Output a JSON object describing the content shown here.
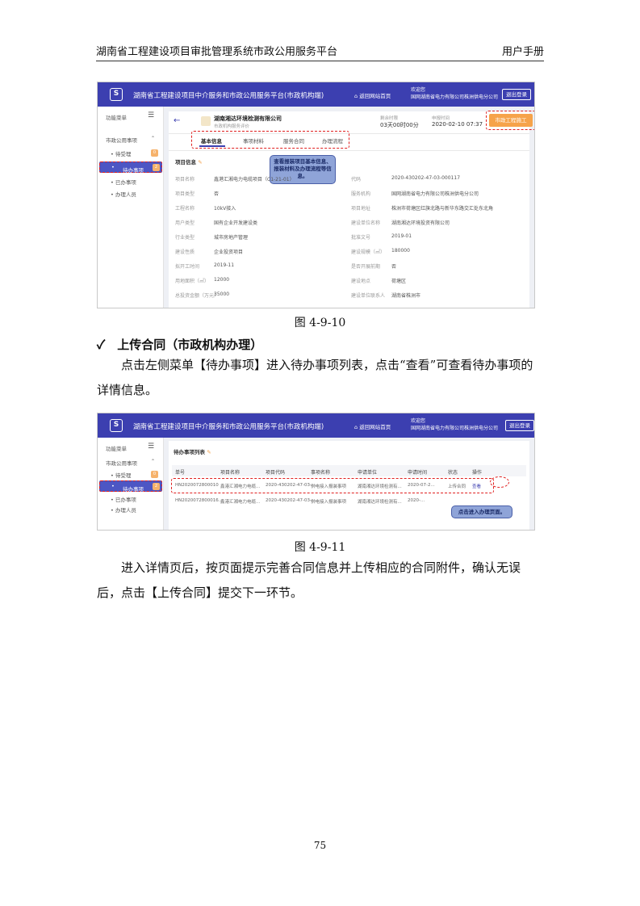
{
  "header": {
    "left": "湖南省工程建设项目审批管理系统市政公用服务平台",
    "right": "用户手册"
  },
  "shot1": {
    "app_title": "湖南省工程建设项目中介服务和市政公用服务平台(市政机构端)",
    "home": "返回网站首页",
    "welcome": "欢迎您",
    "org": "国网湖南省电力有限公司株洲供电分公司",
    "logout": "退出登录",
    "sidebar": {
      "title": "功能菜单",
      "group": "市政公用事项",
      "items": [
        "待受理",
        "待办事项",
        "已办事项",
        "办理人员"
      ],
      "badges": [
        "0",
        "2"
      ]
    },
    "company": "湖南湘达环境检测有限公司",
    "company_sub": "市政机构服务评价",
    "time_label": "剩余时限",
    "time_value": "03天00时00分",
    "apply_label": "申报时间",
    "apply_value": "2020-02-10 07:37",
    "start_btn": "市政工程施工",
    "tabs": [
      "基本信息",
      "事项材料",
      "服务合同",
      "办理流程"
    ],
    "section": "项目信息",
    "tip": "查看报装项目基本信息、报装材料及办理流程等信息。",
    "left_fields": [
      {
        "label": "项目名称",
        "value": "鑫港汇湘电力电缆项目（C1-21-01）"
      },
      {
        "label": "项目类型",
        "value": "否"
      },
      {
        "label": "工程名称",
        "value": "10kV接入"
      },
      {
        "label": "用户类型",
        "value": "国有企业开发建设类"
      },
      {
        "label": "行业类型",
        "value": "城市房地产管理"
      },
      {
        "label": "建设性质",
        "value": "企业投资项目"
      },
      {
        "label": "拟开工时间",
        "value": "2019-11"
      },
      {
        "label": "用地面积（㎡）",
        "value": "12000"
      },
      {
        "label": "总投资金额（万元）",
        "value": "35000"
      }
    ],
    "right_fields": [
      {
        "label": "代码",
        "value": "2020-430202-47-03-000117"
      },
      {
        "label": "服务机构",
        "value": "国网湖南省电力有限公司株洲供电分公司"
      },
      {
        "label": "项目地址",
        "value": "株洲市荷塘区红旗北路与新华东路交汇处东北角"
      },
      {
        "label": "建设单位名称",
        "value": "湖南湘达环境投资有限公司"
      },
      {
        "label": "批准文号",
        "value": "2019-01"
      },
      {
        "label": "建设规模（㎡）",
        "value": "180000"
      },
      {
        "label": "是否开展前期",
        "value": "否"
      },
      {
        "label": "建设地点",
        "value": "荷塘区"
      },
      {
        "label": "建设单位联系人",
        "value": "湖南省株洲市"
      }
    ]
  },
  "caption1": "图 4-9-10",
  "heading": "✓　上传合同（市政机构办理）",
  "para1": "点击左侧菜单【待办事项】进入待办事项列表，点击“查看”可查看待办事项的详情信息。",
  "shot2": {
    "section": "待办事项列表",
    "columns": [
      "单号",
      "项目名称",
      "项目代码",
      "事项名称",
      "申请单位",
      "申请时间",
      "状态",
      "操作"
    ],
    "rows": [
      [
        "HN2020072800010",
        "鑫港汇湘电力电缆...",
        "2020-430202-47-03-...",
        "供电接入报装事项",
        "湖南湘达环境检测有...",
        "2020-07-2...",
        "上传合同",
        "查看"
      ],
      [
        "HN2020072800016...",
        "鑫港汇湘电力电缆...",
        "2020-430202-47-03-...",
        "供电接入报装事项",
        "湖南湘达环境检测有...",
        "2020-...",
        "",
        ""
      ]
    ],
    "tip": "点击进入办理页面。"
  },
  "caption2": "图 4-9-11",
  "para2": "进入详情页后，按页面提示完善合同信息并上传相应的合同附件，确认无误后，点击【上传合同】提交下一环节。",
  "page_number": "75"
}
